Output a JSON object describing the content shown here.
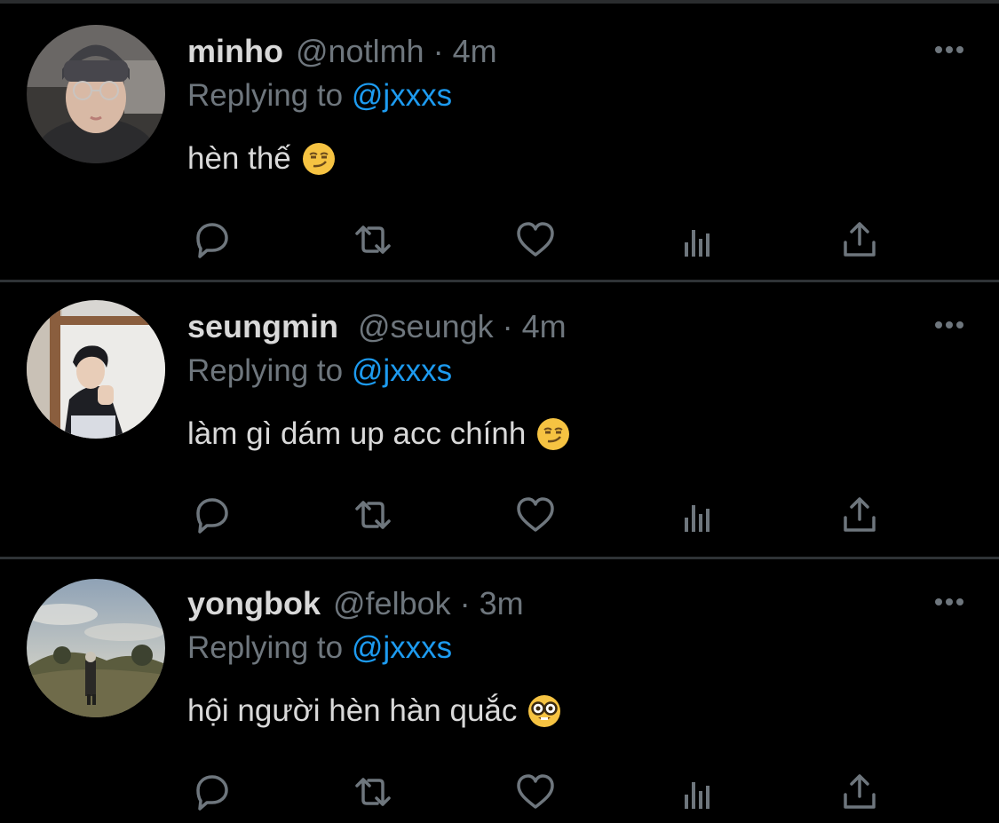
{
  "theme": {
    "background": "#000000",
    "text_primary": "#d9d9d9",
    "text_secondary": "#6e767d",
    "accent": "#1d9bf0",
    "divider": "#2f3336"
  },
  "replying_prefix": "Replying to",
  "tweets": [
    {
      "name": "minho",
      "handle": "@notlmh",
      "separator": "·",
      "time": "4m",
      "replying_to": "@jxxxs",
      "text": "hèn thế",
      "emoji": "smirking-face-emoji",
      "avatar": "minho-avatar"
    },
    {
      "name": "seungmin",
      "handle": "@seungk",
      "separator": "·",
      "time": "4m",
      "replying_to": "@jxxxs",
      "text": "làm gì dám up acc chính",
      "emoji": "smirking-face-emoji",
      "avatar": "seungmin-avatar"
    },
    {
      "name": "yongbok",
      "handle": "@felbok",
      "separator": "·",
      "time": "3m",
      "replying_to": "@jxxxs",
      "text": "hội người hèn hàn quắc",
      "emoji": "nerd-face-emoji",
      "avatar": "yongbok-avatar"
    }
  ],
  "actions": [
    "reply-icon",
    "retweet-icon",
    "like-icon",
    "analytics-icon",
    "share-icon"
  ],
  "more_icon": "more-options-icon"
}
